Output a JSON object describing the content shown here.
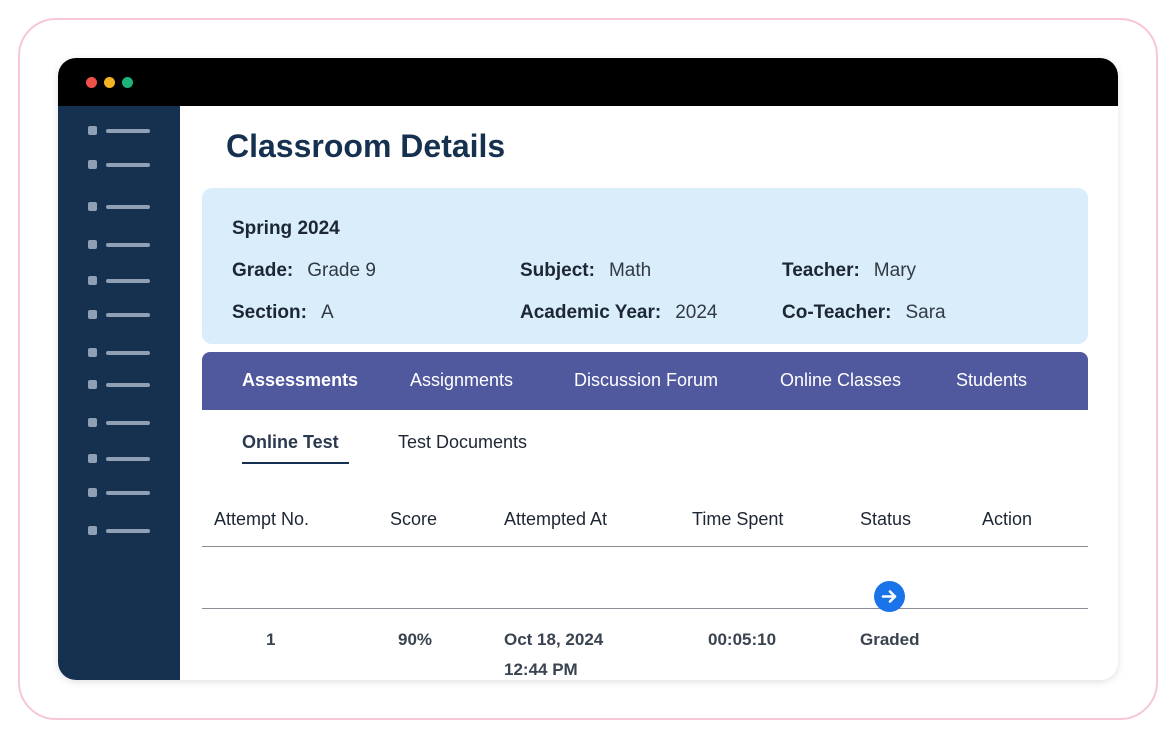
{
  "page": {
    "title": "Classroom Details"
  },
  "sidebar": {
    "item_count": 12
  },
  "info": {
    "term": "Spring 2024",
    "grade_label": "Grade:",
    "grade_value": "Grade 9",
    "subject_label": "Subject:",
    "subject_value": "Math",
    "teacher_label": "Teacher:",
    "teacher_value": "Mary",
    "section_label": "Section:",
    "section_value": "A",
    "year_label": "Academic Year:",
    "year_value": "2024",
    "coteacher_label": "Co-Teacher:",
    "coteacher_value": "Sara"
  },
  "tabs": [
    {
      "label": "Assessments",
      "active": true
    },
    {
      "label": "Assignments",
      "active": false
    },
    {
      "label": "Discussion Forum",
      "active": false
    },
    {
      "label": "Online Classes",
      "active": false
    },
    {
      "label": "Students",
      "active": false
    }
  ],
  "subtabs": [
    {
      "label": "Online Test",
      "active": true
    },
    {
      "label": "Test Documents",
      "active": false
    }
  ],
  "table": {
    "columns": [
      "Attempt No.",
      "Score",
      "Attempted At",
      "Time Spent",
      "Status",
      "Action"
    ],
    "rows": [
      {
        "attempt": "1",
        "score": "90%",
        "attempted_date": "Oct 18, 2024",
        "attempted_time": "12:44 PM",
        "time_spent": "00:05:10",
        "status": "Graded",
        "action_icon": "arrow-right-icon"
      }
    ]
  },
  "colors": {
    "sidebar": "#163150",
    "tabs_bar": "#50589e",
    "info_card": "#d9edfb",
    "action_button": "#1a73e8"
  }
}
